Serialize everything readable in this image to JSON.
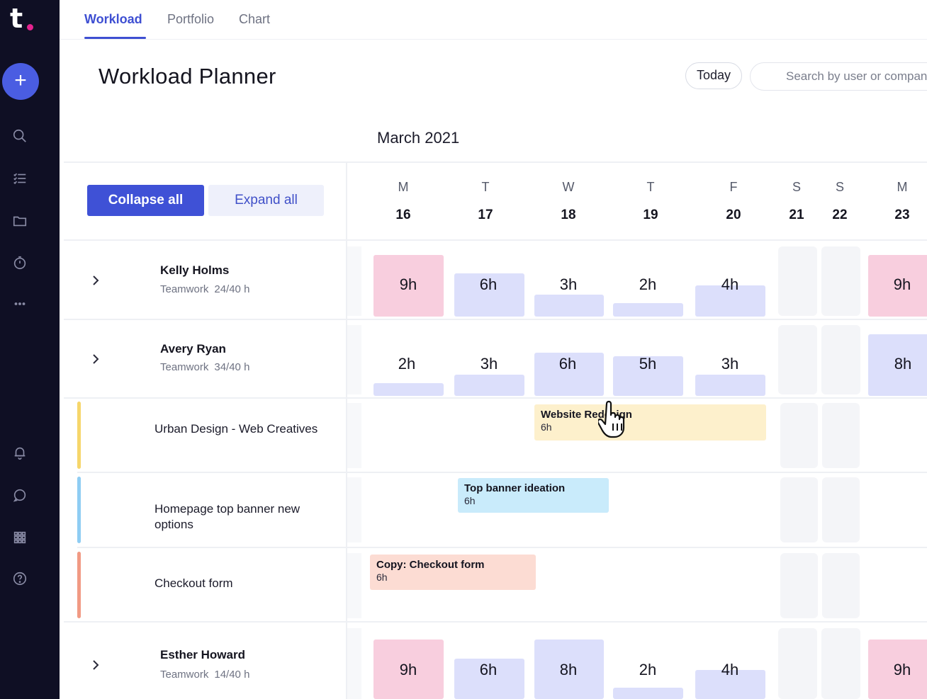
{
  "sidebar": {
    "logo": "t",
    "add_label": "+",
    "icons": [
      "search-icon",
      "tasks-icon",
      "folder-icon",
      "timer-icon",
      "more-icon",
      "bell-icon",
      "chat-icon",
      "apps-icon",
      "help-icon"
    ]
  },
  "tabs": [
    {
      "label": "Workload",
      "active": true
    },
    {
      "label": "Portfolio",
      "active": false
    },
    {
      "label": "Chart",
      "active": false
    }
  ],
  "header": {
    "title": "Workload Planner",
    "today_label": "Today",
    "search_placeholder": "Search by user or company"
  },
  "calendar": {
    "month": "March 2021",
    "days": [
      {
        "letter": "M",
        "num": "16"
      },
      {
        "letter": "T",
        "num": "17"
      },
      {
        "letter": "W",
        "num": "18"
      },
      {
        "letter": "T",
        "num": "19"
      },
      {
        "letter": "F",
        "num": "20"
      },
      {
        "letter": "S",
        "num": "21"
      },
      {
        "letter": "S",
        "num": "22"
      },
      {
        "letter": "M",
        "num": "23"
      }
    ]
  },
  "controls": {
    "collapse_label": "Collapse all",
    "expand_label": "Expand all"
  },
  "people": [
    {
      "name": "Kelly Holms",
      "company": "Teamwork",
      "capacity": "24/40 h",
      "hours": [
        "9h",
        "6h",
        "3h",
        "2h",
        "4h",
        "9h"
      ]
    },
    {
      "name": "Avery Ryan",
      "company": "Teamwork",
      "capacity": "34/40 h",
      "hours": [
        "2h",
        "3h",
        "6h",
        "5h",
        "3h",
        "8h"
      ]
    },
    {
      "name": "Esther Howard",
      "company": "Teamwork",
      "capacity": "14/40 h",
      "hours": [
        "9h",
        "6h",
        "8h",
        "2h",
        "4h",
        "9h"
      ]
    }
  ],
  "tasks": [
    {
      "name": "Urban Design - Web Creatives",
      "block_title": "Website Redesign",
      "block_hours": "6h",
      "color": "#fdf0cc",
      "bar_color": "#f6d66b"
    },
    {
      "name": "Homepage top banner new options",
      "block_title": "Top banner ideation",
      "block_hours": "6h",
      "color": "#c9ebfb",
      "bar_color": "#8fcdf3"
    },
    {
      "name": "Checkout form",
      "block_title": "Copy: Checkout form",
      "block_hours": "6h",
      "color": "#fcdcd3",
      "bar_color": "#f19a84"
    }
  ],
  "colors": {
    "accent": "#3e4fd2",
    "overload": "#f8cede",
    "normal": "#dcdffb",
    "sidebar": "#0f0f24"
  }
}
